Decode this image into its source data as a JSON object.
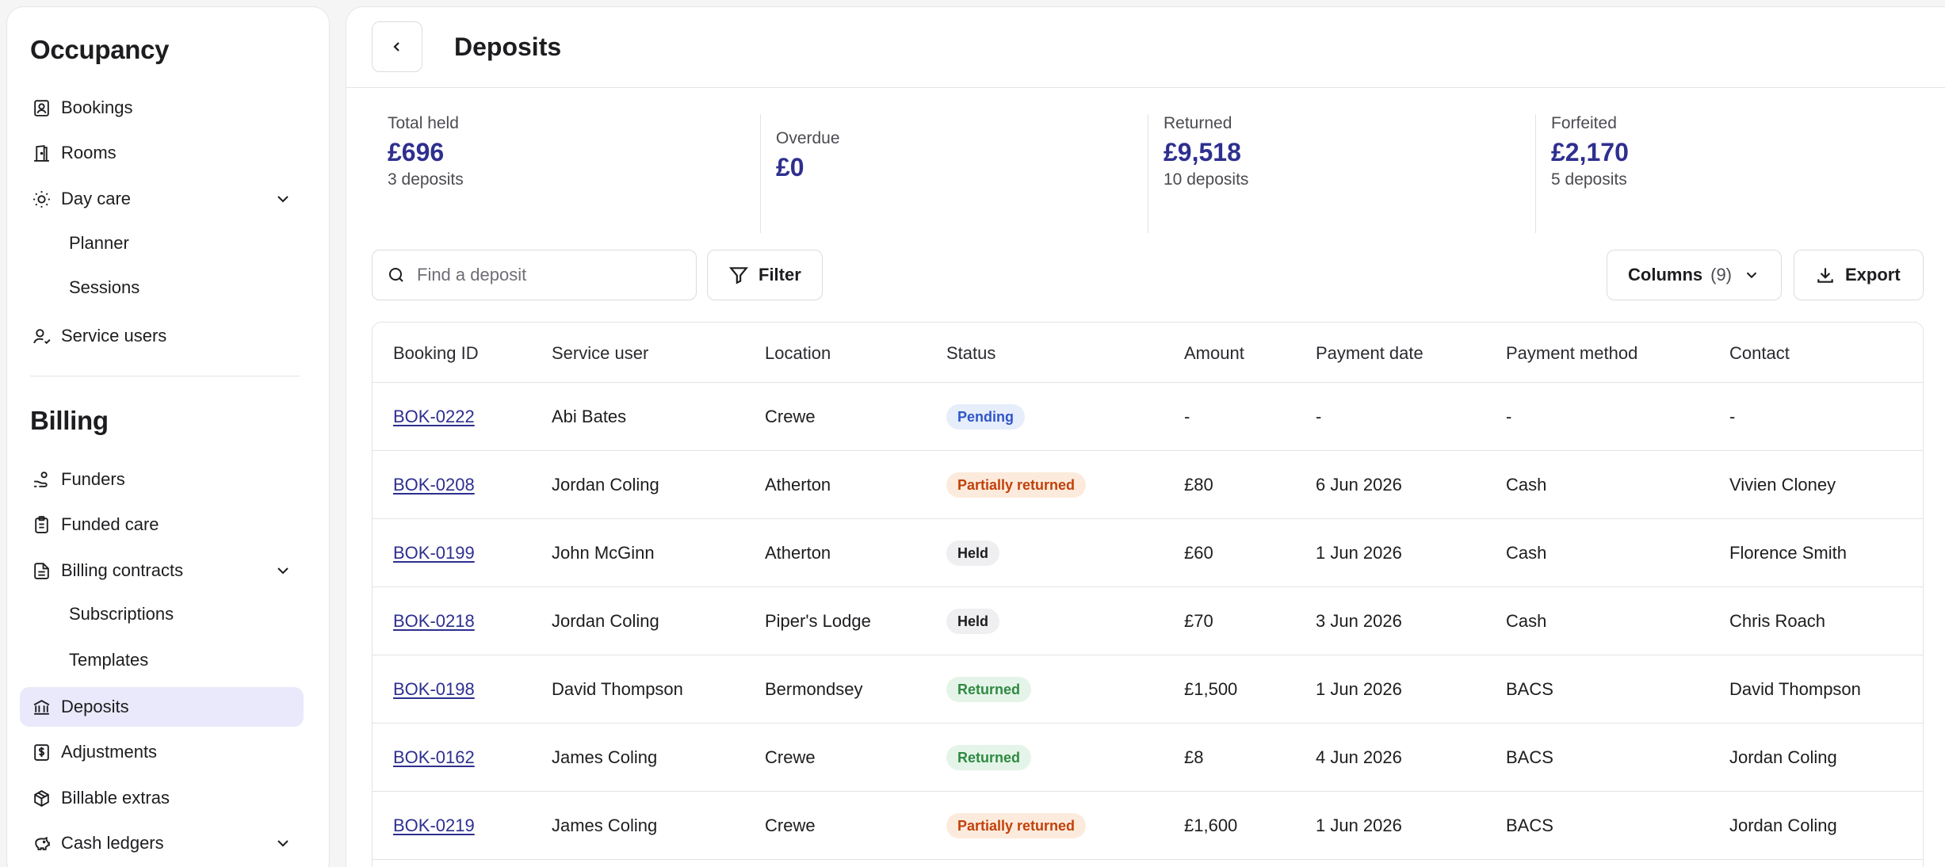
{
  "sidebar": {
    "sections": [
      {
        "title": "Occupancy"
      },
      {
        "title": "Billing"
      }
    ],
    "items": {
      "bookings": "Bookings",
      "rooms": "Rooms",
      "day_care": "Day care",
      "planner": "Planner",
      "sessions": "Sessions",
      "service_users": "Service users",
      "funders": "Funders",
      "funded_care": "Funded care",
      "billing_contracts": "Billing contracts",
      "subscriptions": "Subscriptions",
      "templates": "Templates",
      "deposits": "Deposits",
      "adjustments": "Adjustments",
      "billable_extras": "Billable extras",
      "cash_ledgers": "Cash ledgers"
    },
    "active": "deposits"
  },
  "header": {
    "title": "Deposits"
  },
  "stats": [
    {
      "label": "Total held",
      "value": "£696",
      "sub": "3 deposits"
    },
    {
      "label": "Overdue",
      "value": "£0",
      "sub": ""
    },
    {
      "label": "Returned",
      "value": "£9,518",
      "sub": "10 deposits"
    },
    {
      "label": "Forfeited",
      "value": "£2,170",
      "sub": "5 deposits"
    }
  ],
  "toolbar": {
    "search_placeholder": "Find a deposit",
    "filter_label": "Filter",
    "columns_label": "Columns",
    "columns_count": "(9)",
    "export_label": "Export"
  },
  "table": {
    "columns": [
      "Booking ID",
      "Service user",
      "Location",
      "Status",
      "Amount",
      "Payment date",
      "Payment method",
      "Contact"
    ],
    "rows": [
      {
        "id": "BOK-0222",
        "user": "Abi Bates",
        "location": "Crewe",
        "status": "Pending",
        "status_kind": "pending",
        "amount": "-",
        "date": "-",
        "method": "-",
        "contact": "-"
      },
      {
        "id": "BOK-0208",
        "user": "Jordan Coling",
        "location": "Atherton",
        "status": "Partially returned",
        "status_kind": "partial",
        "amount": "£80",
        "date": "6 Jun 2026",
        "method": "Cash",
        "contact": "Vivien Cloney"
      },
      {
        "id": "BOK-0199",
        "user": "John McGinn",
        "location": "Atherton",
        "status": "Held",
        "status_kind": "held",
        "amount": "£60",
        "date": "1 Jun 2026",
        "method": "Cash",
        "contact": "Florence Smith"
      },
      {
        "id": "BOK-0218",
        "user": "Jordan Coling",
        "location": "Piper's Lodge",
        "status": "Held",
        "status_kind": "held",
        "amount": "£70",
        "date": "3 Jun 2026",
        "method": "Cash",
        "contact": "Chris Roach"
      },
      {
        "id": "BOK-0198",
        "user": "David Thompson",
        "location": "Bermondsey",
        "status": "Returned",
        "status_kind": "returned",
        "amount": "£1,500",
        "date": "1 Jun 2026",
        "method": "BACS",
        "contact": "David Thompson"
      },
      {
        "id": "BOK-0162",
        "user": "James Coling",
        "location": "Crewe",
        "status": "Returned",
        "status_kind": "returned",
        "amount": "£8",
        "date": "4 Jun 2026",
        "method": "BACS",
        "contact": "Jordan Coling"
      },
      {
        "id": "BOK-0219",
        "user": "James Coling",
        "location": "Crewe",
        "status": "Partially returned",
        "status_kind": "partial",
        "amount": "£1,600",
        "date": "1 Jun 2026",
        "method": "BACS",
        "contact": "Jordan Coling"
      }
    ]
  },
  "colors": {
    "accent": "#2e2f8f",
    "active_bg": "#e9e9fb"
  }
}
